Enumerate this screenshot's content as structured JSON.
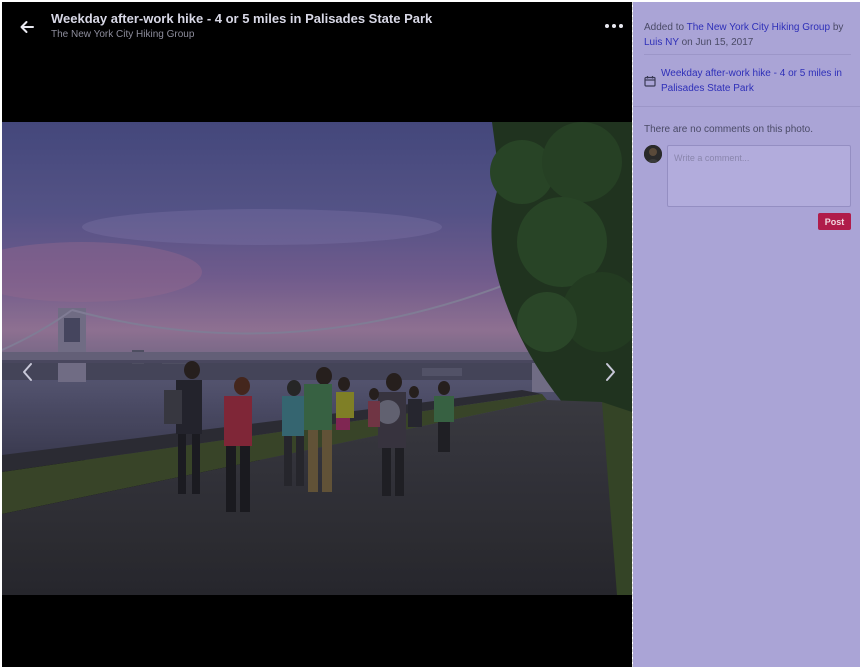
{
  "header": {
    "title": "Weekday after-work hike - 4 or 5 miles in Palisades State Park",
    "group_name": "The New York City Hiking Group"
  },
  "icons": {
    "back": "arrow-left-icon",
    "more": "more-horizontal-icon",
    "prev": "chevron-left-icon",
    "next": "chevron-right-icon",
    "event": "calendar-icon"
  },
  "photo": {
    "description_alt": "Group of hikers walking along a riverside path toward the George Washington Bridge at dusk"
  },
  "sidebar": {
    "added_to_prefix": "Added to ",
    "group_link": "The New York City Hiking Group",
    "by_text": " by ",
    "author_link": "Luis NY",
    "date_text": " on Jun 15, 2017",
    "event_link": "Weekday after-work hike - 4 or 5 miles in Palisades State Park",
    "no_comments_text": "There are no comments on this photo.",
    "comment_placeholder": "Write a comment...",
    "post_label": "Post"
  },
  "colors": {
    "sidebar_bg": "#aaa4d6",
    "link": "#2e2fb8",
    "post_button": "#b01c4a"
  }
}
